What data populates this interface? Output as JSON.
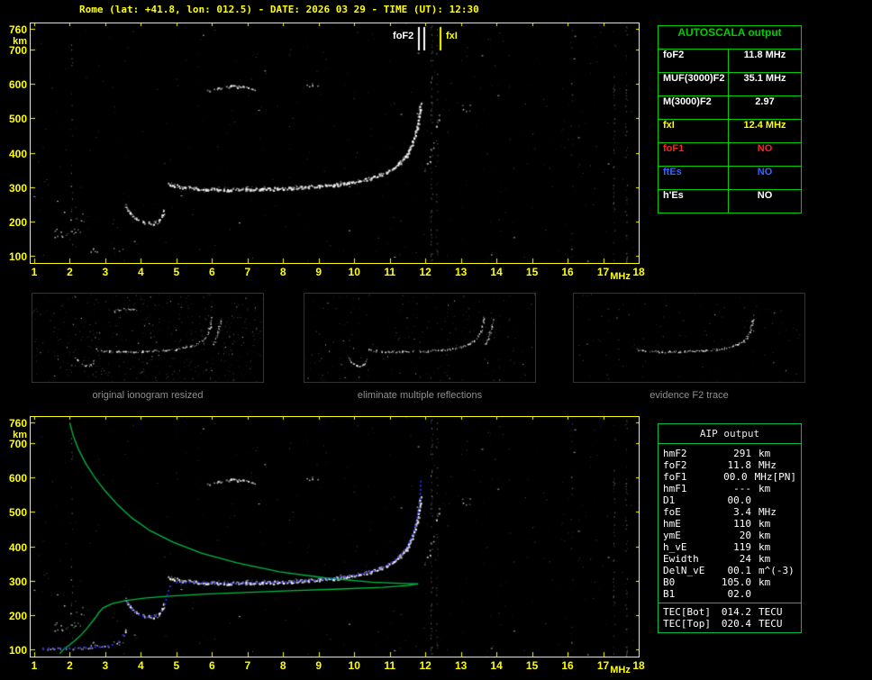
{
  "header": {
    "title": "Rome (lat: +41.8, lon: 012.5) - DATE: 2026 03 29 - TIME (UT): 12:30"
  },
  "colors": {
    "axis": "#ffff00",
    "trace_white": "#ffffff",
    "table_green": "#00cc00",
    "profile_green": "#00bb44",
    "fit_blue": "#2a2af0",
    "value_red": "#ff2222",
    "value_blue": "#3366ff",
    "caption_gray": "#8f8f8f"
  },
  "autoscala_table": {
    "title": "AUTOSCALA output",
    "rows": [
      {
        "label": "foF2",
        "value": "11.8 MHz",
        "color": "#ffffff"
      },
      {
        "label": "MUF(3000)F2",
        "value": "35.1 MHz",
        "color": "#ffffff"
      },
      {
        "label": "M(3000)F2",
        "value": "2.97",
        "color": "#ffffff"
      },
      {
        "label": "fxI",
        "value": "12.4 MHz",
        "color": "#ffff00"
      },
      {
        "label": "foF1",
        "value": "NO",
        "color": "#ff2222"
      },
      {
        "label": "ftEs",
        "value": "NO",
        "color": "#3366ff"
      },
      {
        "label": "h'Es",
        "value": "NO",
        "color": "#ffffff"
      }
    ]
  },
  "aip_table": {
    "title": "AIP output",
    "rows": [
      {
        "label": "hmF2",
        "value": "291",
        "unit": "km",
        "extra": ""
      },
      {
        "label": "foF2",
        "value": "11.8",
        "unit": "MHz",
        "extra": ""
      },
      {
        "label": "foF1",
        "value": "00.0",
        "unit": "MHz",
        "extra": "[PN]"
      },
      {
        "label": "hmF1",
        "value": "---",
        "unit": "km",
        "extra": ""
      },
      {
        "label": "D1",
        "value": "00.0",
        "unit": "",
        "extra": ""
      },
      {
        "label": "foE",
        "value": "3.4",
        "unit": "MHz",
        "extra": ""
      },
      {
        "label": "hmE",
        "value": "110",
        "unit": "km",
        "extra": ""
      },
      {
        "label": "ymE",
        "value": "20",
        "unit": "km",
        "extra": ""
      },
      {
        "label": "h_vE",
        "value": "119",
        "unit": "km",
        "extra": ""
      },
      {
        "label": "Ewidth",
        "value": "24",
        "unit": "km",
        "extra": ""
      },
      {
        "label": "DelN_vE",
        "value": "00.1",
        "unit": "m^(-3)",
        "extra": ""
      },
      {
        "label": "B0",
        "value": "105.0",
        "unit": "km",
        "extra": ""
      },
      {
        "label": "B1",
        "value": "02.0",
        "unit": "",
        "extra": ""
      }
    ],
    "tec_rows": [
      {
        "label": "TEC[Bot]",
        "value": "014.2",
        "unit": "TECU"
      },
      {
        "label": "TEC[Top]",
        "value": "020.4",
        "unit": "TECU"
      }
    ]
  },
  "thumbnails": [
    {
      "caption": "original ionogram resized",
      "noise_count": 520,
      "show": [
        "e_hook",
        "f2_main",
        "second_hop",
        "x_branch"
      ]
    },
    {
      "caption": "eliminate multiple reflections",
      "noise_count": 240,
      "show": [
        "e_hook",
        "f2_main",
        "x_branch"
      ]
    },
    {
      "caption": "evidence F2 trace",
      "noise_count": 130,
      "show": [
        "f2_main"
      ]
    }
  ],
  "thumb_axes": {
    "x_range": [
      0.9,
      15
    ],
    "y_range": [
      80,
      700
    ]
  },
  "chart_data": [
    {
      "type": "scatter",
      "name": "autoscaled ionogram",
      "xlabel": "MHz",
      "ylabel": "km",
      "x_range": [
        0.9,
        18
      ],
      "y_range": [
        80,
        775
      ],
      "x_ticks": [
        1,
        2,
        3,
        4,
        5,
        6,
        7,
        8,
        9,
        10,
        11,
        12,
        13,
        14,
        15,
        16,
        17,
        18
      ],
      "y_ticks": [
        760,
        700,
        600,
        500,
        400,
        300,
        200,
        100
      ],
      "markers": [
        {
          "label": "foF2",
          "freq": 11.8,
          "color": "#ffffff",
          "double": true,
          "side": "left"
        },
        {
          "label": "fxI",
          "freq": 12.4,
          "color": "#ffff00",
          "double": false,
          "side": "right"
        }
      ],
      "traces": {
        "e_hook": [
          [
            3.55,
            248
          ],
          [
            3.68,
            228
          ],
          [
            3.85,
            210
          ],
          [
            4.08,
            199
          ],
          [
            4.32,
            197
          ],
          [
            4.5,
            204
          ],
          [
            4.6,
            218
          ],
          [
            4.66,
            238
          ]
        ],
        "f2_main": [
          [
            4.75,
            310
          ],
          [
            5.1,
            302
          ],
          [
            5.6,
            297
          ],
          [
            6.2,
            294
          ],
          [
            6.9,
            294
          ],
          [
            7.6,
            296
          ],
          [
            8.3,
            299
          ],
          [
            9.0,
            304
          ],
          [
            9.6,
            310
          ],
          [
            10.1,
            318
          ],
          [
            10.55,
            330
          ],
          [
            10.95,
            347
          ],
          [
            11.25,
            370
          ],
          [
            11.5,
            400
          ],
          [
            11.65,
            435
          ],
          [
            11.75,
            472
          ],
          [
            11.82,
            512
          ],
          [
            11.86,
            545
          ]
        ],
        "x_branch": [
          [
            11.95,
            345
          ],
          [
            12.1,
            380
          ],
          [
            12.22,
            425
          ],
          [
            12.32,
            475
          ],
          [
            12.4,
            520
          ]
        ],
        "second_hop": [
          [
            5.85,
            580
          ],
          [
            6.15,
            589
          ],
          [
            6.5,
            594
          ],
          [
            6.9,
            592
          ],
          [
            7.25,
            584
          ]
        ]
      },
      "patches": [
        {
          "f": 1.85,
          "km": 168,
          "n": 16,
          "sf": 0.45,
          "skm": 14
        },
        {
          "f": 8.8,
          "km": 597,
          "n": 7,
          "sf": 0.25,
          "skm": 6
        },
        {
          "f": 3.0,
          "km": 120,
          "n": 8,
          "sf": 0.5,
          "skm": 8
        },
        {
          "f": 13.1,
          "km": 530,
          "n": 5,
          "sf": 0.15,
          "skm": 12
        },
        {
          "f": 2.1,
          "km": 210,
          "n": 6,
          "sf": 0.3,
          "skm": 20
        }
      ],
      "noise_columns": [
        {
          "f": 12.17,
          "n": 70
        },
        {
          "f": 12.32,
          "n": 26
        },
        {
          "f": 16.1,
          "n": 16
        },
        {
          "f": 17.3,
          "n": 40
        },
        {
          "f": 17.65,
          "n": 46
        },
        {
          "f": 2.05,
          "n": 20
        }
      ],
      "noise_count": 420
    },
    {
      "type": "scatter",
      "name": "restored ionogram with AIP electron density profile",
      "xlabel": "MHz",
      "ylabel": "km",
      "x_range": [
        0.9,
        18
      ],
      "y_range": [
        80,
        775
      ],
      "x_ticks": [
        1,
        2,
        3,
        4,
        5,
        6,
        7,
        8,
        9,
        10,
        11,
        12,
        13,
        14,
        15,
        16,
        17,
        18
      ],
      "y_ticks": [
        760,
        700,
        600,
        500,
        400,
        300,
        200,
        100
      ],
      "scatter_same_as": 0,
      "blue_trace": [
        [
          3.62,
          238
        ],
        [
          3.75,
          216
        ],
        [
          3.95,
          201
        ],
        [
          4.18,
          194
        ],
        [
          4.42,
          199
        ],
        [
          4.58,
          212
        ],
        [
          4.68,
          232
        ],
        [
          4.74,
          258
        ],
        [
          4.82,
          284
        ],
        [
          5.0,
          295
        ],
        [
          5.5,
          296
        ],
        [
          6.2,
          293
        ],
        [
          6.9,
          293
        ],
        [
          7.6,
          295
        ],
        [
          8.3,
          298
        ],
        [
          9.0,
          303
        ],
        [
          9.6,
          309
        ],
        [
          10.1,
          317
        ],
        [
          10.55,
          329
        ],
        [
          10.95,
          346
        ],
        [
          11.25,
          369
        ],
        [
          11.5,
          399
        ],
        [
          11.65,
          434
        ],
        [
          11.75,
          471
        ],
        [
          11.82,
          511
        ],
        [
          11.86,
          552
        ],
        [
          11.88,
          600
        ]
      ],
      "blue_e_trace": [
        [
          1.25,
          104
        ],
        [
          1.7,
          104
        ],
        [
          2.15,
          105
        ],
        [
          2.6,
          106
        ],
        [
          2.95,
          109
        ],
        [
          3.2,
          114
        ],
        [
          3.38,
          124
        ],
        [
          3.5,
          142
        ],
        [
          3.56,
          162
        ]
      ],
      "white_e_trace": [
        [
          1.25,
          104
        ],
        [
          1.7,
          104
        ],
        [
          2.15,
          105
        ],
        [
          2.6,
          106
        ],
        [
          2.95,
          109
        ],
        [
          3.2,
          114
        ],
        [
          3.38,
          124
        ],
        [
          3.5,
          142
        ],
        [
          3.56,
          162
        ]
      ],
      "green_profile": [
        [
          2.0,
          758
        ],
        [
          2.1,
          720
        ],
        [
          2.25,
          680
        ],
        [
          2.45,
          640
        ],
        [
          2.7,
          600
        ],
        [
          3.0,
          560
        ],
        [
          3.35,
          520
        ],
        [
          3.75,
          482
        ],
        [
          4.25,
          446
        ],
        [
          4.9,
          412
        ],
        [
          5.7,
          380
        ],
        [
          6.7,
          352
        ],
        [
          7.9,
          326
        ],
        [
          9.2,
          308
        ],
        [
          10.5,
          296
        ],
        [
          11.4,
          292
        ],
        [
          11.8,
          291
        ],
        [
          11.5,
          286
        ],
        [
          10.8,
          281
        ],
        [
          9.6,
          276
        ],
        [
          8.2,
          271
        ],
        [
          6.9,
          266
        ],
        [
          5.8,
          261
        ],
        [
          4.9,
          256
        ],
        [
          4.15,
          250
        ],
        [
          3.6,
          243
        ],
        [
          3.2,
          234
        ],
        [
          2.95,
          222
        ],
        [
          2.82,
          208
        ],
        [
          2.72,
          193
        ],
        [
          2.6,
          177
        ],
        [
          2.47,
          160
        ],
        [
          2.32,
          143
        ],
        [
          2.15,
          127
        ],
        [
          1.97,
          112
        ],
        [
          1.82,
          100
        ],
        [
          1.72,
          88
        ]
      ]
    }
  ]
}
